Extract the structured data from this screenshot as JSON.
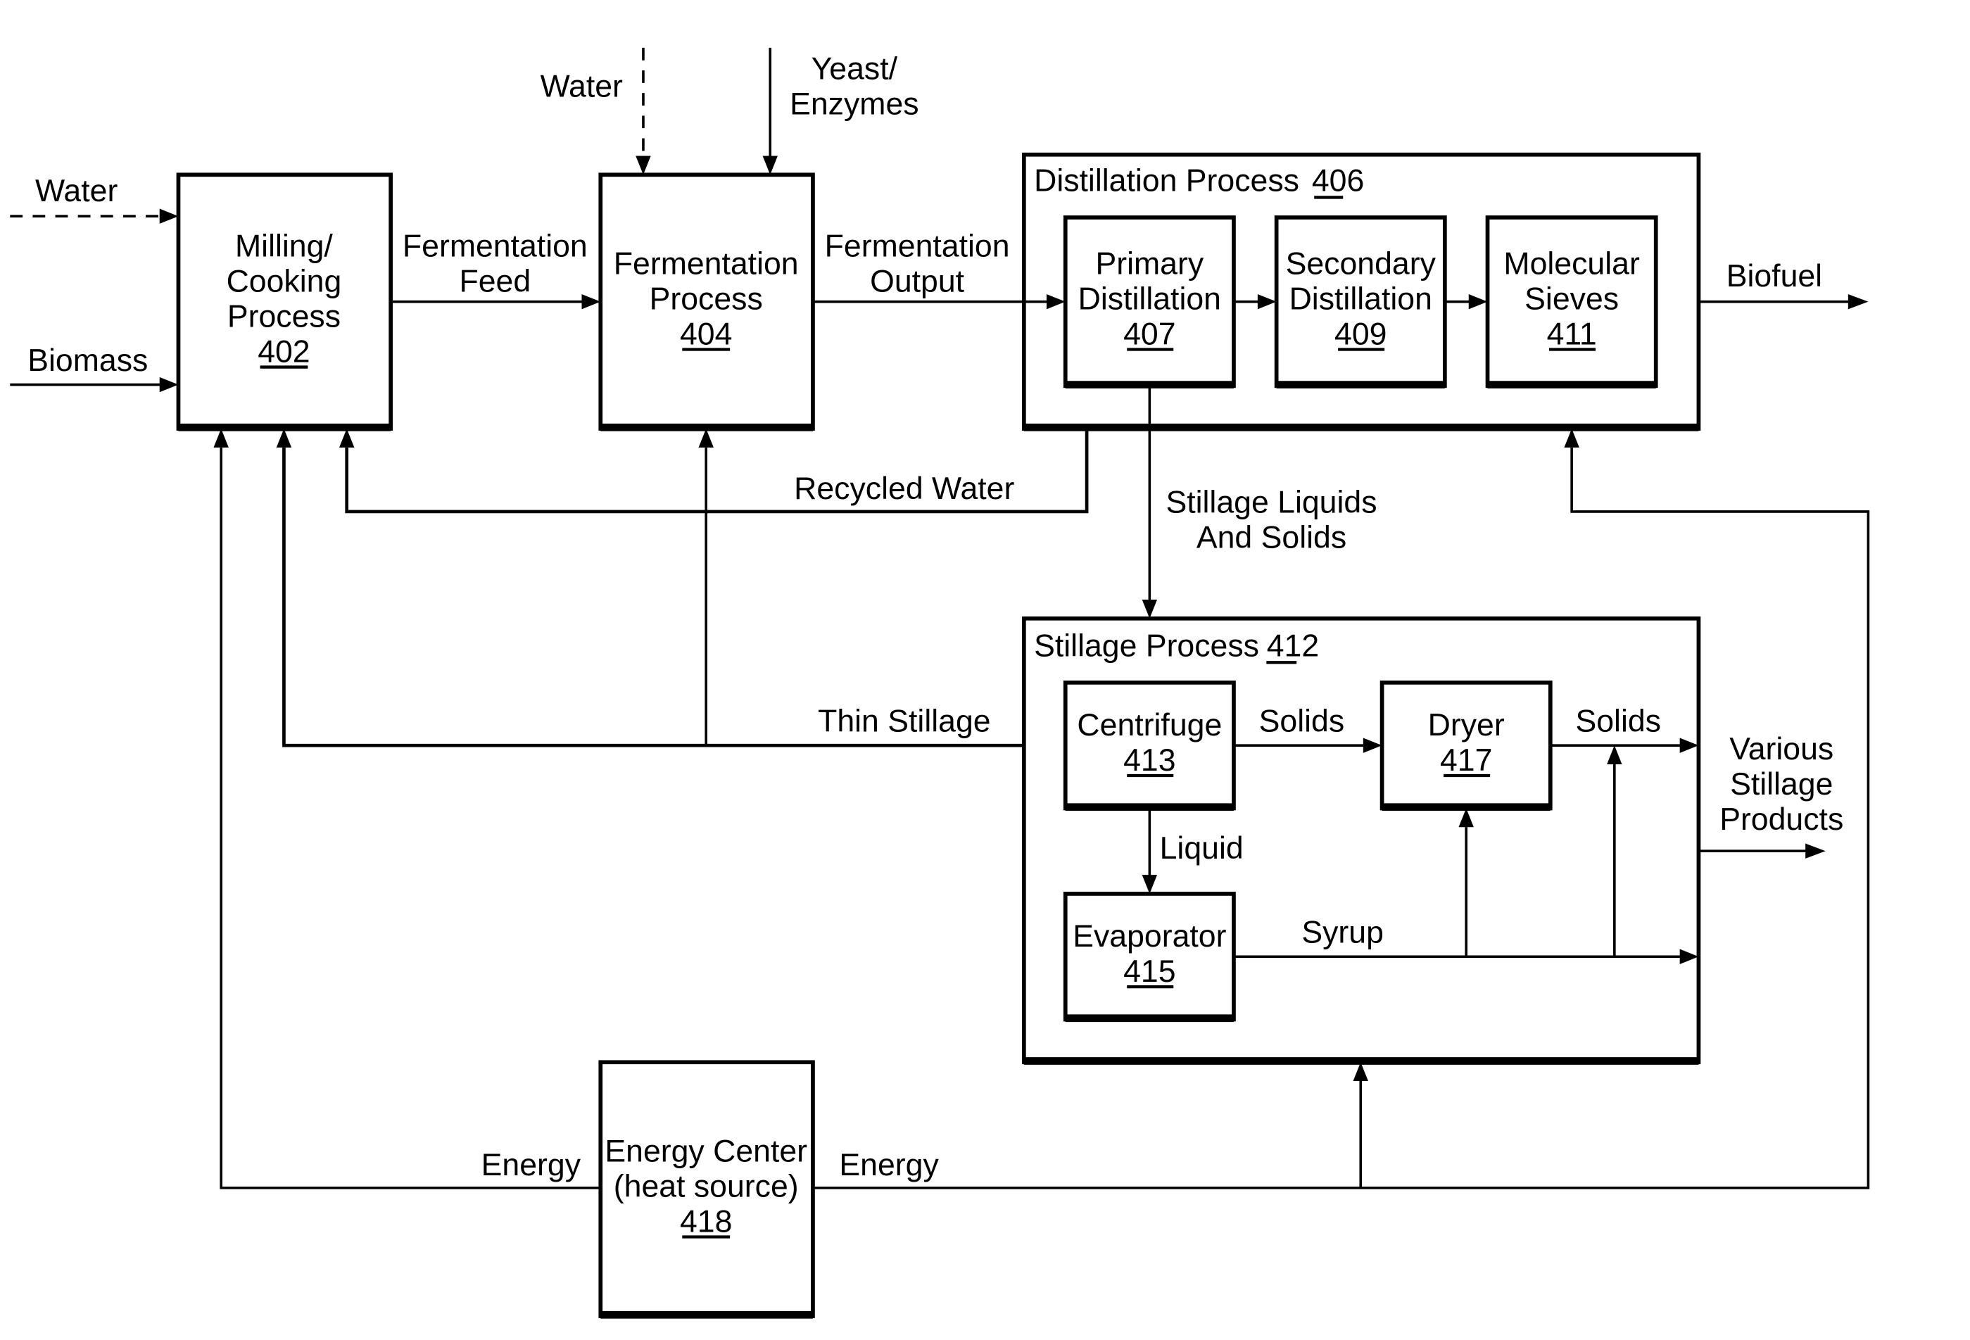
{
  "diagram": {
    "type": "process-flow-diagram",
    "inputs": {
      "water_milling": "Water",
      "biomass": "Biomass",
      "water_fermentation": "Water",
      "yeast_line1": "Yeast/",
      "yeast_line2": "Enzymes"
    },
    "blocks": {
      "milling": {
        "line1": "Milling/",
        "line2": "Cooking",
        "line3": "Process",
        "ref": "402"
      },
      "fermentation": {
        "line1": "Fermentation",
        "line2": "Process",
        "ref": "404"
      },
      "distillation": {
        "title": "Distillation Process",
        "ref_prefix": "4",
        "ref_underlined": "06"
      },
      "primary": {
        "line1": "Primary",
        "line2": "Distillation",
        "ref": "407"
      },
      "secondary": {
        "line1": "Secondary",
        "line2": "Distillation",
        "ref": "409"
      },
      "sieves": {
        "line1": "Molecular",
        "line2": "Sieves",
        "ref": "411"
      },
      "stillage": {
        "title": "Stillage Process",
        "ref_prefix": "4",
        "ref_underlined": "12"
      },
      "centrifuge": {
        "line1": "Centrifuge",
        "ref": "413"
      },
      "dryer": {
        "line1": "Dryer",
        "ref": "417"
      },
      "evaporator": {
        "line1": "Evaporator",
        "ref": "415"
      },
      "energy": {
        "line1": "Energy Center",
        "line2": "(heat source)",
        "ref": "418"
      }
    },
    "flows": {
      "fermentation_feed_1": "Fermentation",
      "fermentation_feed_2": "Feed",
      "fermentation_output_1": "Fermentation",
      "fermentation_output_2": "Output",
      "biofuel": "Biofuel",
      "recycled_water": "Recycled Water",
      "stillage_liquids_1": "Stillage Liquids",
      "stillage_liquids_2": "And Solids",
      "thin_stillage": "Thin Stillage",
      "solids_1": "Solids",
      "solids_2": "Solids",
      "liquid": "Liquid",
      "syrup": "Syrup",
      "various_1": "Various",
      "various_2": "Stillage",
      "various_3": "Products",
      "energy_left": "Energy",
      "energy_right": "Energy"
    },
    "connections": [
      {
        "from": "Water",
        "to": "Milling/Cooking Process 402",
        "style": "dashed"
      },
      {
        "from": "Biomass",
        "to": "Milling/Cooking Process 402"
      },
      {
        "from": "Milling/Cooking Process 402",
        "to": "Fermentation Process 404",
        "label": "Fermentation Feed"
      },
      {
        "from": "Water",
        "to": "Fermentation Process 404",
        "style": "dashed"
      },
      {
        "from": "Yeast/Enzymes",
        "to": "Fermentation Process 404"
      },
      {
        "from": "Fermentation Process 404",
        "to": "Primary Distillation 407",
        "label": "Fermentation Output"
      },
      {
        "from": "Primary Distillation 407",
        "to": "Secondary Distillation 409"
      },
      {
        "from": "Secondary Distillation 409",
        "to": "Molecular Sieves 411"
      },
      {
        "from": "Distillation Process 406",
        "to": "Biofuel"
      },
      {
        "from": "Distillation Process 406",
        "to": "Milling/Cooking Process 402",
        "label": "Recycled Water"
      },
      {
        "from": "Primary Distillation 407",
        "to": "Stillage Process 412",
        "label": "Stillage Liquids And Solids"
      },
      {
        "from": "Stillage Process 412",
        "to": "Milling/Cooking Process 402",
        "label": "Thin Stillage"
      },
      {
        "from": "Stillage Process 412",
        "to": "Fermentation Process 404",
        "label": "Thin Stillage"
      },
      {
        "from": "Centrifuge 413",
        "to": "Dryer 417",
        "label": "Solids"
      },
      {
        "from": "Centrifuge 413",
        "to": "Evaporator 415",
        "label": "Liquid"
      },
      {
        "from": "Evaporator 415",
        "to": "Dryer 417",
        "label": "Syrup"
      },
      {
        "from": "Dryer 417",
        "to": "Various Stillage Products",
        "label": "Solids"
      },
      {
        "from": "Evaporator 415",
        "to": "Various Stillage Products",
        "label": "Syrup"
      },
      {
        "from": "Energy Center 418",
        "to": "Milling/Cooking Process 402",
        "label": "Energy"
      },
      {
        "from": "Energy Center 418",
        "to": "Stillage Process 412",
        "label": "Energy"
      },
      {
        "from": "Energy Center 418",
        "to": "Distillation Process 406",
        "label": "Energy"
      }
    ]
  }
}
